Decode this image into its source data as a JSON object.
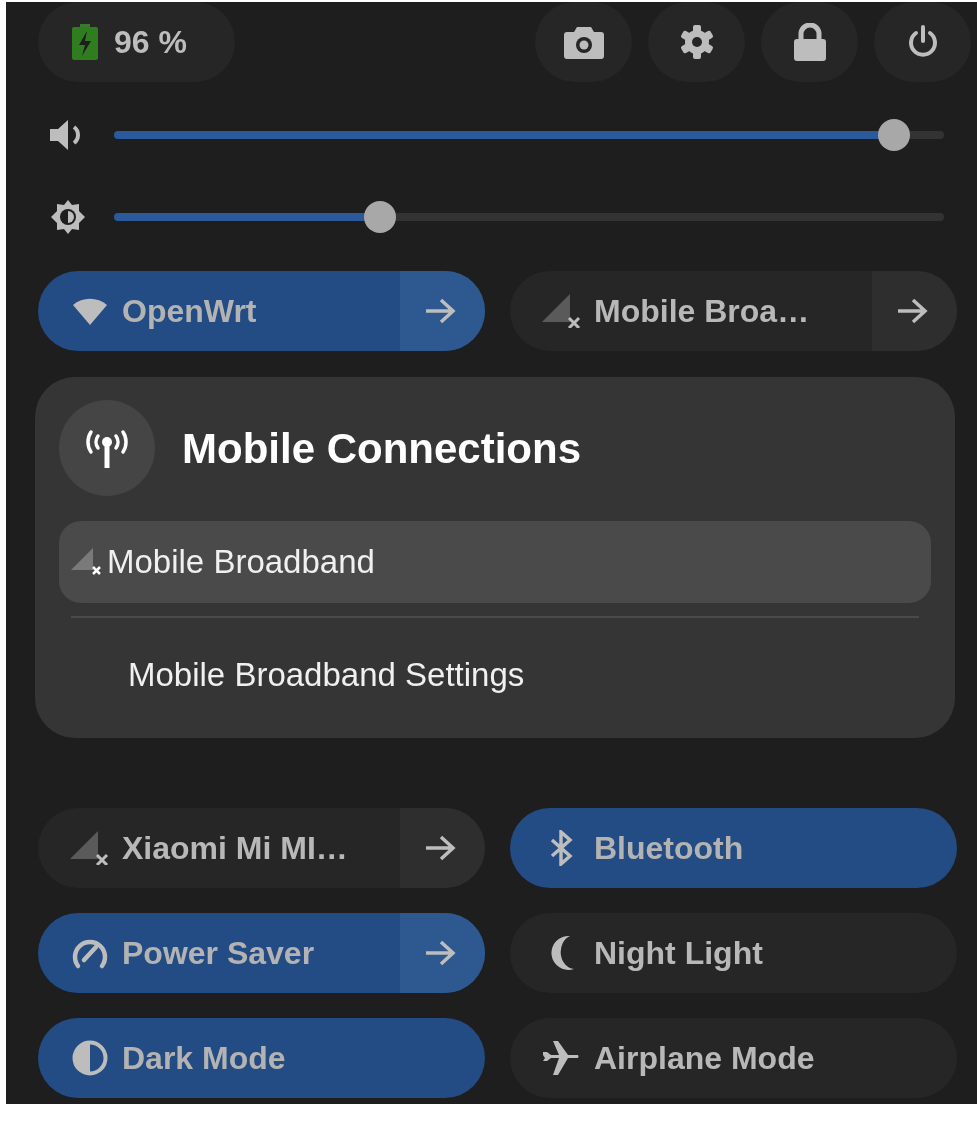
{
  "battery": {
    "label": "96 %"
  },
  "sliders": [
    {
      "kind": "volume",
      "level": 0.94
    },
    {
      "kind": "brightness",
      "level": 0.32
    }
  ],
  "toggles_top": [
    {
      "label": "OpenWrt",
      "kind": "split",
      "checked": true
    },
    {
      "label": "Mobile Broa…",
      "kind": "split",
      "checked": false
    }
  ],
  "menu": {
    "title": "Mobile Connections",
    "items": [
      {
        "label": "Mobile Broadband",
        "selected": true
      }
    ],
    "settings": "Mobile Broadband Settings"
  },
  "toggles_bottom": [
    {
      "label": "Xiaomi Mi MI…",
      "kind": "split",
      "checked": false
    },
    {
      "label": "Bluetooth",
      "kind": "plain",
      "checked": true
    },
    {
      "label": "Power Saver",
      "kind": "split",
      "checked": true
    },
    {
      "label": "Night Light",
      "kind": "plain",
      "checked": false
    },
    {
      "label": "Dark Mode",
      "kind": "plain",
      "checked": true
    },
    {
      "label": "Airplane Mode",
      "kind": "plain",
      "checked": false
    }
  ]
}
